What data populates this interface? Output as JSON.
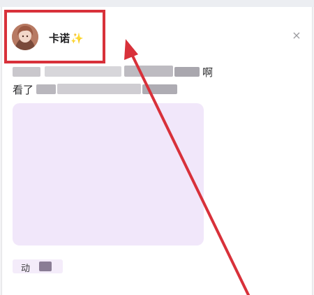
{
  "dialog": {
    "author": {
      "name": "卡诺",
      "emoji": "✨",
      "avatar_icon": "avatar-portrait"
    },
    "close_icon": "×",
    "post_lines": [
      {
        "visible_end": "啊"
      },
      {
        "visible_start": "看了"
      }
    ],
    "tag": {
      "label": "动"
    }
  },
  "annotation": {
    "color": "#d8313a"
  }
}
